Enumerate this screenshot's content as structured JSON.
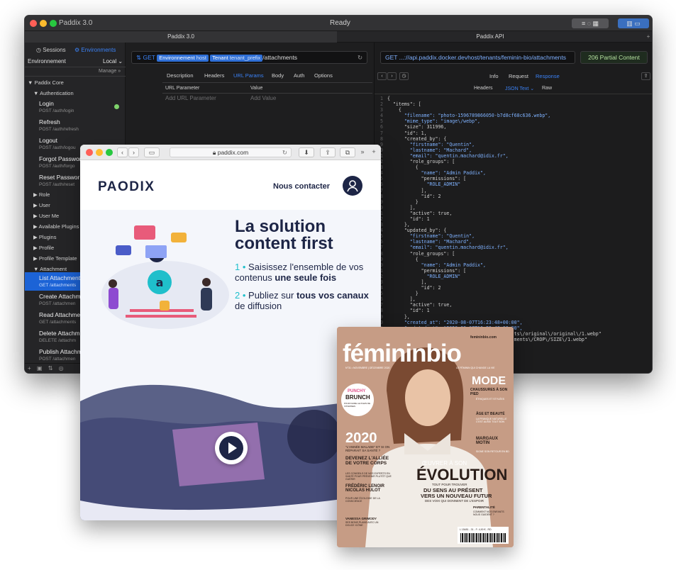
{
  "app": {
    "title": "Paddix 3.0",
    "status": "Ready",
    "tabs": [
      "Paddix 3.0",
      "Paddix API"
    ],
    "sidebar": {
      "segments": [
        "Sessions",
        "Environments"
      ],
      "environment_label": "Environnement",
      "environment_value": "Local",
      "manage_label": "Manage",
      "root": "Paddix Core",
      "section": "Authentication",
      "auth_items": [
        {
          "name": "Login",
          "route": "POST /auth/login"
        },
        {
          "name": "Refresh",
          "route": "POST /auth/refresh"
        },
        {
          "name": "Logout",
          "route": "POST /auth/logou"
        },
        {
          "name": "Forgot Passwor",
          "route": "POST /auth/forgo"
        },
        {
          "name": "Reset Passwor",
          "route": "POST /auth/reset"
        }
      ],
      "groups": [
        "Role",
        "User",
        "User Me",
        "Available Plugins",
        "Plugins",
        "Profile",
        "Profile Template",
        "Attachment"
      ],
      "attachment_items": [
        {
          "name": "List Attachment",
          "route": "GET /attachments"
        },
        {
          "name": "Create Attachm",
          "route": "POST /attachmen"
        },
        {
          "name": "Read Attachmen",
          "route": "GET /attachments"
        },
        {
          "name": "Delete Attachm",
          "route": "DELETE /attachm"
        },
        {
          "name": "Publish Attachm",
          "route": "POST /attachmen"
        }
      ]
    },
    "request": {
      "method": "GET",
      "token_env": "Environnement",
      "token_env_sub": "host",
      "token_tenant": "Tenant",
      "token_tenant_sub": "tenant_prefix",
      "path": "/attachments",
      "tabs": [
        "Description",
        "Headers",
        "URL Params",
        "Body",
        "Auth",
        "Options"
      ],
      "active_tab": "URL Params",
      "param_col_name": "URL Parameter",
      "param_col_value": "Value",
      "param_placeholder_name": "Add URL Parameter",
      "param_placeholder_value": "Add Value"
    },
    "response": {
      "url": "GET  ...://api.paddix.docker.devhost/tenants/feminin-bio/attachments",
      "status": "206 Partial Content",
      "tabs": [
        "Info",
        "Request",
        "Response"
      ],
      "active_tab": "Response",
      "subtabs": [
        "Headers",
        "JSON Text",
        "Raw"
      ],
      "active_subtab": "JSON Text",
      "lines": [
        "{",
        "  \"items\": [",
        "    {",
        "      \"filename\": \"photo-1596789866050-b7d8cf68c636.webp\",",
        "      \"mime_type\": \"image\\/webp\",",
        "      \"size\": 311996,",
        "      \"id\": 1,",
        "      \"created_by\": {",
        "        \"firstname\": \"Quentin\",",
        "        \"lastname\": \"Machard\",",
        "        \"email\": \"quentin.machard@idix.fr\",",
        "        \"role_groups\": [",
        "          {",
        "            \"name\": \"Admin Paddix\",",
        "            \"permissions\": [",
        "              \"ROLE_ADMIN\"",
        "            ],",
        "            \"id\": 2",
        "          }",
        "        ],",
        "        \"active\": true,",
        "        \"id\": 1",
        "      },",
        "      \"updated_by\": {",
        "        \"firstname\": \"Quentin\",",
        "        \"lastname\": \"Machard\",",
        "        \"email\": \"quentin.machard@idix.fr\",",
        "        \"role_groups\": [",
        "          {",
        "            \"name\": \"Admin Paddix\",",
        "            \"permissions\": [",
        "              \"ROLE_ADMIN\"",
        "            ],",
        "            \"id\": 2",
        "          }",
        "        ],",
        "        \"active\": true,",
        "        \"id\": 1",
        "      },",
        "      \"created_at\": \"2020-08-07T16:23:48+00:00\",",
        "      \"updated_at\": \"2020-08-07T16:23:48+00:00\",",
        "                                  \\/attachments\\/original\\/original\\/1.webp\"",
        "                                  bio\\/attachments\\/CROP\\/SIZE\\/1.webp\""
      ]
    }
  },
  "browser": {
    "url": "paddix.com",
    "logo": "PAODIX",
    "contact": "Nous contacter",
    "headline": "La solution content first",
    "point1_num": "1 •",
    "point1_text": "Saisissez l'ensemble de vos contenus",
    "point1_bold": "une seule fois",
    "point2_num": "2 •",
    "point2_text": "Publiez sur",
    "point2_bold": "tous vos canaux",
    "point2_tail": "de diffusion"
  },
  "magazine": {
    "brand": "fémininbio",
    "site": "femininbio.com",
    "issue": "N°31 • NOVEMBRE | DÉCEMBRE 2020",
    "tagline": "LE FÉMININ QUI CHANGE LA VIE",
    "badge_line1": "PUNCHY",
    "badge_line2": "BRUNCH",
    "badge_line3": "POUR FAIRE LE PLEIN DE VITAMINES",
    "left_year": "2020",
    "left_sub": "\"L'ANNÉE MALADE\" ET SI ON RÉPARAIT SA SANTÉ ?",
    "left_h1": "DEVENEZ L'ALLIÉE DE VOTRE CORPS",
    "left_p1": "LES CONSEILS DE NOS EXPERTS EN SANTÉ POUR PRÉVENIR PLUTÔT QUE GUÉRIR",
    "left_names": "FRÉDÉRIC LENOIR NICOLAS HULOT",
    "left_names_sub": "POUR UNE ÉCOLOGIE DE LA CONSCIENCE",
    "left_vanessa": "VANESSA GRIMODY",
    "left_vanessa_sub": "SES BONS PLANS AVEC UN DOUCE ICÔNE",
    "right_mode": "MODE",
    "right_mode_sub": "CHAUSSURES À SON PIED",
    "right_mode_sub2": "ÉTHIQUES ET STYLÉES",
    "right_beaute": "ÂGE ET BEAUTÉ",
    "right_beaute_sub": "LA FRANQUE NATURELLE C'EST AUSSI TOUT BON",
    "right_motin": "MARGAUX MOTIN",
    "right_motin_sub": "SIGNE SON RETOUR EN BD",
    "right_parent": "PARENTALITÉ",
    "right_parent_sub": "COMMENT NOS ENFANTS NOUS GUIDENT ?",
    "cover_small": "ŒUVRER À SON",
    "cover_big": "ÉVOLUTION",
    "cover_sub1": "TOUT POUR TROUVER",
    "cover_sub2": "DU SENS AU PRÉSENT",
    "cover_sub3": "VERS UN NOUVEAU FUTUR",
    "cover_sub4": "DES VOIX QUI DONNENT DE L'ESPOIR",
    "price": "L 15481 - 31 - F: 4,90 € - RD"
  },
  "colors": {
    "accent": "#1c63d6",
    "status_ok": "#b6e3a0",
    "brand_navy": "#1d2546",
    "brand_teal": "#1fbfcb",
    "magazine_bg": "#c9a08a"
  }
}
